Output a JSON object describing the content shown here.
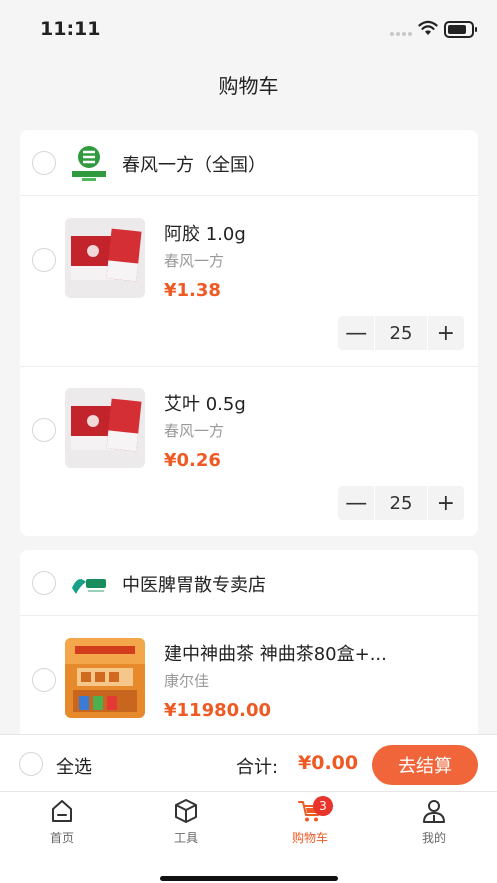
{
  "status_bar": {
    "time": "11:11"
  },
  "header": {
    "title": "购物车"
  },
  "stores": [
    {
      "name": "春风一方（全国）",
      "logo": "chunfeng-logo",
      "items": [
        {
          "name": "阿胶 1.0g",
          "brand": "春风一方",
          "price": "¥1.38",
          "quantity": "25"
        },
        {
          "name": "艾叶 0.5g",
          "brand": "春风一方",
          "price": "¥0.26",
          "quantity": "25"
        }
      ]
    },
    {
      "name": "中医脾胃散专卖店",
      "logo": "kangerjia-logo",
      "items": [
        {
          "name": "建中神曲茶 神曲茶80盒+...",
          "brand": "康尔佳",
          "price": "¥11980.00"
        }
      ]
    }
  ],
  "stepper": {
    "minus": "—",
    "plus": "+"
  },
  "footer": {
    "select_all": "全选",
    "total_label": "合计:",
    "total_value": "¥0.00",
    "checkout": "去结算"
  },
  "tabs": [
    {
      "label": "首页",
      "icon": "home-icon"
    },
    {
      "label": "工具",
      "icon": "cube-icon"
    },
    {
      "label": "购物车",
      "icon": "cart-icon",
      "active": true,
      "badge": "3"
    },
    {
      "label": "我的",
      "icon": "user-icon"
    }
  ],
  "colors": {
    "accent": "#ef5a24",
    "badge": "#e8342b",
    "background": "#f5f5f5"
  }
}
